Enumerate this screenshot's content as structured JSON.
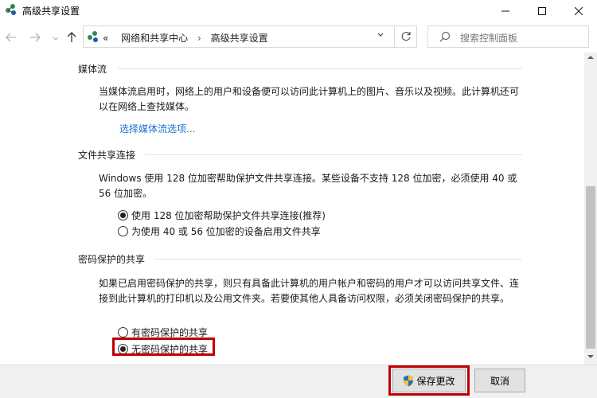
{
  "window": {
    "title": "高级共享设置",
    "minimize_icon": "minimize-icon",
    "maximize_icon": "maximize-icon",
    "close_icon": "close-icon"
  },
  "navigation": {
    "back_icon": "arrow-left-icon",
    "forward_icon": "arrow-right-icon",
    "recent_icon": "chevron-down-icon",
    "up_icon": "arrow-up-icon",
    "address": {
      "overflow": "«",
      "crumbs": [
        "网络和共享中心",
        "高级共享设置"
      ],
      "separator": "›"
    },
    "refresh_icon": "refresh-icon",
    "search": {
      "placeholder": "搜索控制面板"
    }
  },
  "sections": {
    "media": {
      "title": "媒体流",
      "description": "当媒体流启用时，网络上的用户和设备便可以访问此计算机上的图片、音乐以及视频。此计算机还可以在网络上查找媒体。",
      "link": "选择媒体流选项..."
    },
    "file_sharing": {
      "title": "文件共享连接",
      "description": "Windows 使用 128 位加密帮助保护文件共享连接。某些设备不支持 128 位加密，必须使用 40 或 56 位加密。",
      "options": [
        {
          "label": "使用 128 位加密帮助保护文件共享连接(推荐)",
          "checked": true
        },
        {
          "label": "为使用 40 或 56 位加密的设备启用文件共享",
          "checked": false
        }
      ]
    },
    "password": {
      "title": "密码保护的共享",
      "description": "如果已启用密码保护的共享，则只有具备此计算机的用户帐户和密码的用户才可以访问共享文件、连接到此计算机的打印机以及公用文件夹。若要使其他人具备访问权限，必须关闭密码保护的共享。",
      "options": [
        {
          "label": "有密码保护的共享",
          "checked": false
        },
        {
          "label": "无密码保护的共享",
          "checked": true
        }
      ]
    }
  },
  "footer": {
    "save_label": "保存更改",
    "cancel_label": "取消"
  },
  "colors": {
    "link": "#1a6fcf",
    "highlight": "#c00000"
  }
}
